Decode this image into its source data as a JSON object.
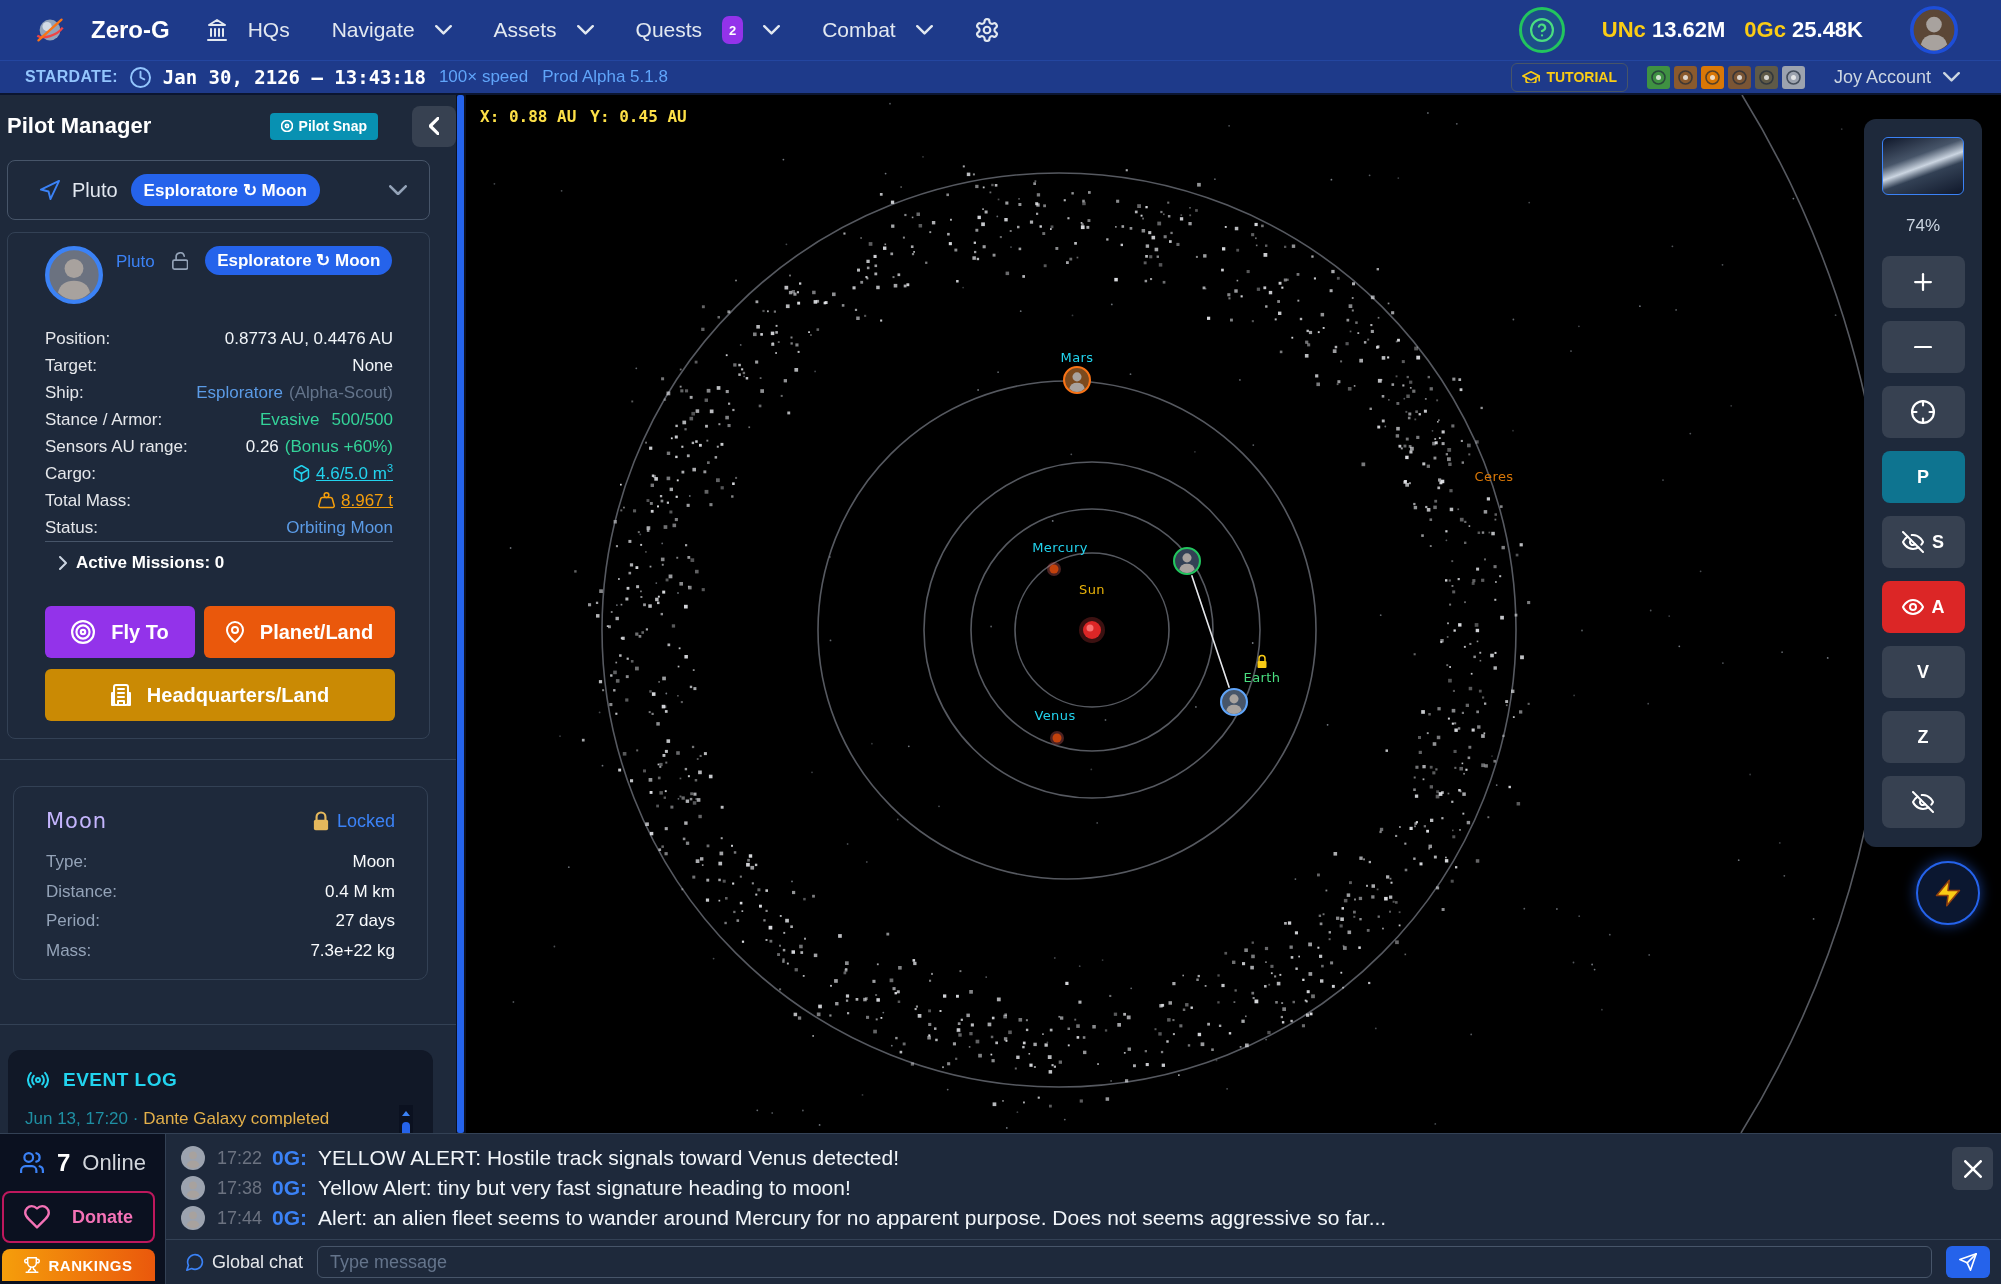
{
  "top_nav": {
    "brand": "Zero-G",
    "menu": [
      {
        "label": "HQs",
        "kind": "icon_link"
      },
      {
        "label": "Navigate",
        "kind": "dropdown"
      },
      {
        "label": "Assets",
        "kind": "dropdown"
      },
      {
        "label": "Quests",
        "kind": "dropdown",
        "badge": "2"
      },
      {
        "label": "Combat",
        "kind": "dropdown"
      }
    ],
    "balances": [
      {
        "currency": "UNc",
        "amount": "13.62M"
      },
      {
        "currency": "0Gc",
        "amount": "25.48K"
      }
    ]
  },
  "status_bar": {
    "label": "STARDATE:",
    "datetime": "Jan 30, 2126 — 13:43:18",
    "speed": "100× speed",
    "version": "Prod Alpha 5.1.8",
    "tutorial": "TUTORIAL",
    "badges": [
      {
        "color": "#3f9142"
      },
      {
        "color": "#8a5a2e"
      },
      {
        "color": "#d97706"
      },
      {
        "color": "#7a5535"
      },
      {
        "color": "#5f5a48"
      },
      {
        "color": "#9ca3af"
      }
    ],
    "account": "Joy Account"
  },
  "pilot_manager": {
    "title": "Pilot Manager",
    "snap_button": "Pilot Snap",
    "selector": {
      "pilot": "Pluto",
      "assignment": "Esploratore ↻ Moon"
    },
    "pilot": {
      "name": "Pluto",
      "locked": false,
      "assignment": "Esploratore ↻ Moon",
      "details": [
        {
          "label": "Position:",
          "kind": "text",
          "value": [
            {
              "text": "0.8773 AU, 0.4476 AU",
              "kind": "plain"
            }
          ]
        },
        {
          "label": "Target:",
          "kind": "text",
          "value": [
            {
              "text": "None",
              "kind": "plain"
            }
          ]
        },
        {
          "label": "Ship:",
          "kind": "text",
          "value": [
            {
              "text": "Esploratore",
              "kind": "accent"
            },
            {
              "text": "(Alpha-Scout)",
              "kind": "muted"
            }
          ]
        },
        {
          "label": "Stance / Armor:",
          "kind": "text",
          "value": [
            {
              "text": "Evasive",
              "kind": "good"
            },
            {
              "text": "500/500",
              "kind": "good"
            }
          ]
        },
        {
          "label": "Sensors AU range:",
          "kind": "text",
          "value": [
            {
              "text": "0.26",
              "kind": "plain"
            },
            {
              "text": "(Bonus +60%)",
              "kind": "good"
            }
          ]
        },
        {
          "label": "Cargo:",
          "kind": "cargo",
          "value": [
            {
              "text": "4.6/5.0 m$^{3}$",
              "kind": "cyan"
            }
          ]
        },
        {
          "label": "Total Mass:",
          "kind": "mass",
          "value": [
            {
              "text": "8.967 t",
              "kind": "amber"
            }
          ]
        },
        {
          "label": "Status:",
          "kind": "text",
          "value": [
            {
              "text": "Orbiting Moon",
              "kind": "accent"
            }
          ]
        }
      ],
      "missions": {
        "label": "Active Missions: 0",
        "expanded": false
      },
      "actions": [
        {
          "label": "Fly To",
          "kind": "fly"
        },
        {
          "label": "Planet/Land",
          "kind": "land"
        },
        {
          "label": "Headquarters/Land",
          "kind": "hq"
        }
      ]
    }
  },
  "moon": {
    "title": "Moon",
    "locked": true,
    "status": "Locked",
    "rows": [
      {
        "label": "Type:",
        "value": "Moon"
      },
      {
        "label": "Distance:",
        "value": "0.4 M km"
      },
      {
        "label": "Period:",
        "value": "27 days"
      },
      {
        "label": "Mass:",
        "value": "7.3e+22 kg"
      }
    ]
  },
  "event_log": {
    "title": "EVENT LOG",
    "entries": [
      {
        "time": "Jun 13, 17:20 ·",
        "text": "Dante Galaxy completed"
      }
    ]
  },
  "map": {
    "coordinates": {
      "x": "X: 0.88 AU",
      "y": "Y: 0.45 AU"
    },
    "bodies": [
      {
        "name": "Sun",
        "kind": "star",
        "color": "#eab308",
        "locked": false
      },
      {
        "name": "Mercury",
        "kind": "planet",
        "color": "#22d3ee",
        "locked": false
      },
      {
        "name": "Venus",
        "kind": "planet",
        "color": "#22d3ee",
        "locked": false
      },
      {
        "name": "Earth",
        "kind": "occupied",
        "color": "#4ade80",
        "locked": true
      },
      {
        "name": "Mars",
        "kind": "occupied",
        "color": "#22d3ee",
        "locked": false
      },
      {
        "name": "Ceres",
        "kind": "label",
        "color": "#d97706",
        "locked": false
      }
    ],
    "controls": {
      "zoom": "74%",
      "buttons": [
        {
          "kind": "zoom_in"
        },
        {
          "kind": "zoom_out"
        },
        {
          "kind": "recenter"
        },
        {
          "kind": "layer",
          "label": "P",
          "active": true,
          "color": "#0e7490"
        },
        {
          "kind": "layer",
          "label": "S",
          "active": false,
          "visible": false
        },
        {
          "kind": "layer",
          "label": "A",
          "active": true,
          "color": "#dc2626",
          "visible": true
        },
        {
          "kind": "layer",
          "label": "V",
          "active": false
        },
        {
          "kind": "layer",
          "label": "Z",
          "active": false
        },
        {
          "kind": "layer",
          "active": false,
          "visible": false
        }
      ]
    }
  },
  "chat": {
    "online": {
      "count": "7",
      "label": "Online"
    },
    "donate": "Donate",
    "rankings": "RANKINGS",
    "messages": [
      {
        "time": "17:22",
        "sender": "0G:",
        "text": "YELLOW ALERT: Hostile track signals toward Venus detected!"
      },
      {
        "time": "17:38",
        "sender": "0G:",
        "text": "Yellow Alert: tiny but very fast signature heading to moon!"
      },
      {
        "time": "17:44",
        "sender": "0G:",
        "text": "Alert: an alien fleet seems to wander around Mercury for no apparent purpose. Does not seems aggressive so far..."
      }
    ],
    "channel": "Global chat",
    "input": {
      "placeholder": "Type message"
    }
  }
}
